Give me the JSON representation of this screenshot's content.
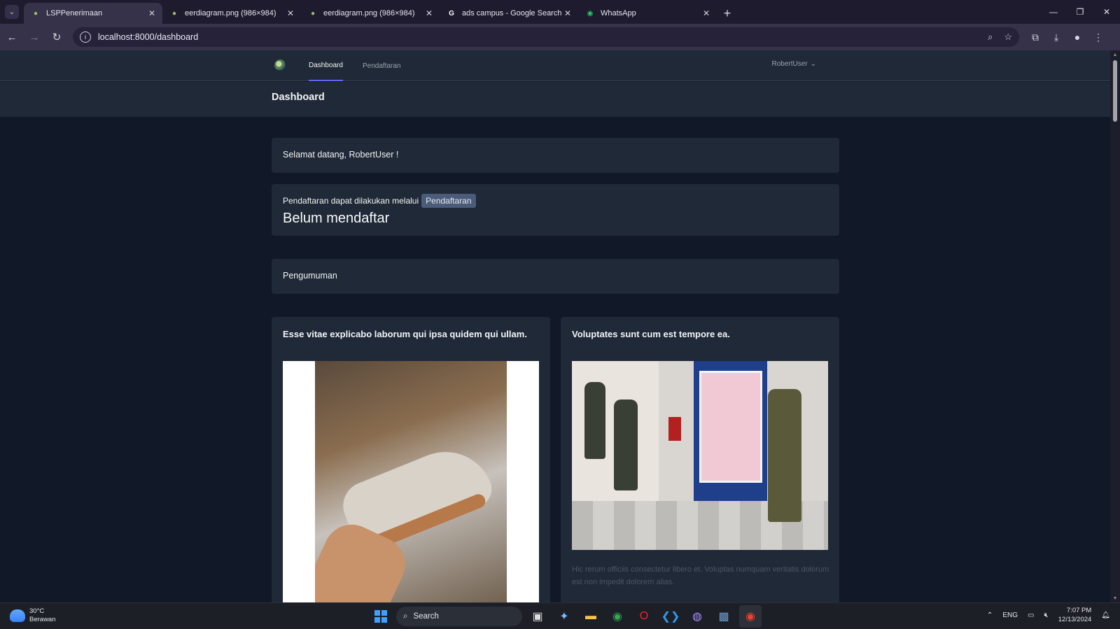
{
  "browser": {
    "tabs": [
      {
        "title": "LSPPenerimaan",
        "active": true
      },
      {
        "title": "eerdiagram.png (986×984)",
        "active": false
      },
      {
        "title": "eerdiagram.png (986×984)",
        "active": false
      },
      {
        "title": "ads campus - Google Search",
        "active": false
      },
      {
        "title": "WhatsApp",
        "active": false
      }
    ],
    "url": "localhost:8000/dashboard"
  },
  "nav": {
    "links": [
      {
        "label": "Dashboard",
        "active": true
      },
      {
        "label": "Pendaftaran",
        "active": false
      }
    ],
    "user": "RobertUser"
  },
  "header": {
    "title": "Dashboard"
  },
  "welcome": {
    "text": "Selamat datang, RobertUser !"
  },
  "registration": {
    "text": "Pendaftaran dapat dilakukan melalui",
    "button": "Pendaftaran",
    "status": "Belum mendaftar"
  },
  "announcement": {
    "title": "Pengumuman"
  },
  "posts": [
    {
      "title": "Esse vitae explicabo laborum qui ipsa quidem qui ullam.",
      "image": "sneaker-photo",
      "description": ""
    },
    {
      "title": "Voluptates sunt cum est tempore ea.",
      "image": "campus-hallway-photo",
      "description": "Hic rerum officiis consectetur libero et. Voluptas numquam veritatis dolorum est non impedit dolorem alias."
    }
  ],
  "taskbar": {
    "weather_temp": "30°C",
    "weather_desc": "Berawan",
    "search": "Search",
    "lang": "ENG",
    "time": "7:07 PM",
    "date": "12/13/2024"
  },
  "colors": {
    "accent": "#6366f1",
    "page_bg": "#111827",
    "card_bg": "#1f2937"
  }
}
